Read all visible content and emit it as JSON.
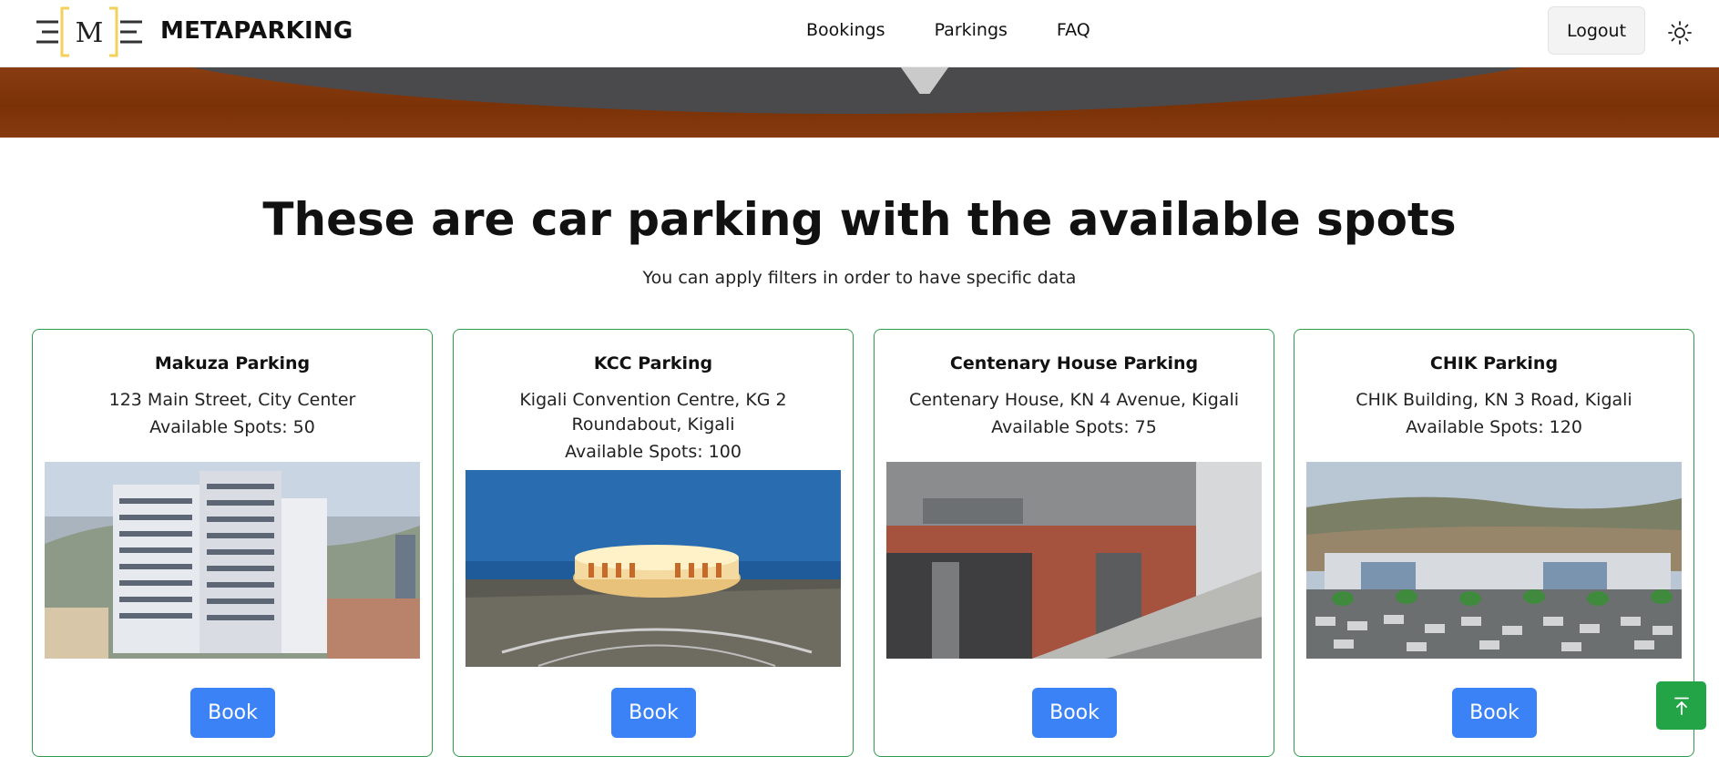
{
  "header": {
    "brand": "METAPARKING",
    "logo_letter": "M",
    "nav": [
      "Bookings",
      "Parkings",
      "FAQ"
    ],
    "logout_label": "Logout"
  },
  "main": {
    "title": "These are car parking with the available spots",
    "subtitle": "You can apply filters in order to have specific data"
  },
  "parkings": [
    {
      "name": "Makuza Parking",
      "address": "123 Main Street, City Center",
      "spots": "Available Spots: 50",
      "book_label": "Book"
    },
    {
      "name": "KCC Parking",
      "address": "Kigali Convention Centre, KG 2 Roundabout, Kigali",
      "spots": "Available Spots: 100",
      "book_label": "Book"
    },
    {
      "name": "Centenary House Parking",
      "address": "Centenary House, KN 4 Avenue, Kigali",
      "spots": "Available Spots: 75",
      "book_label": "Book"
    },
    {
      "name": "CHIK Parking",
      "address": "CHIK Building, KN 3 Road, Kigali",
      "spots": "Available Spots: 120",
      "book_label": "Book"
    }
  ],
  "colors": {
    "accent_green": "#2e9c4a",
    "book_blue": "#3b82f6",
    "logo_yellow": "#f2d15c"
  },
  "icons": {
    "theme_toggle": "sun-icon",
    "scroll_top": "arrow-up-to-line-icon"
  }
}
